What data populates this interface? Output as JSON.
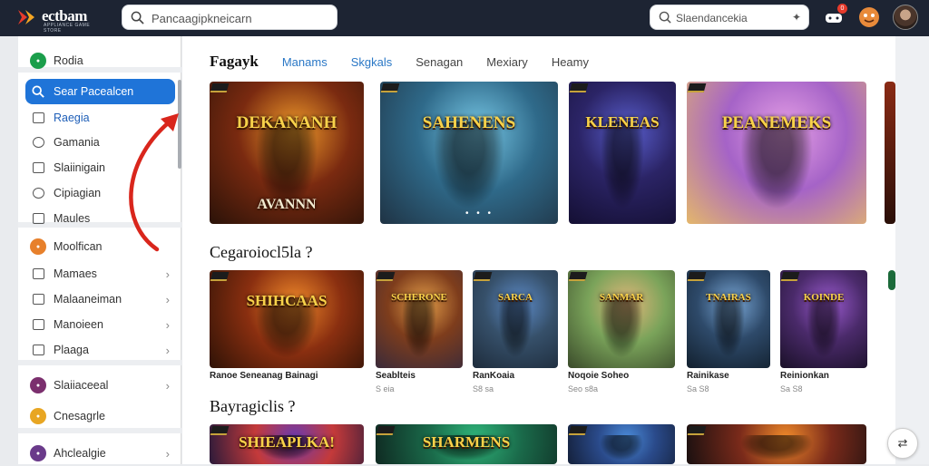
{
  "app": {
    "logo_text": "ectbam",
    "logo_tagline": "APPLIANCE GAME STORE",
    "main_search": {
      "value": "Pancaagipkneicarn",
      "placeholder": ""
    },
    "right_search": {
      "value": "Slaendancekia",
      "placeholder": ""
    },
    "notification_count": "0"
  },
  "sidebar": {
    "items": [
      {
        "label": "Rodia",
        "icon": "home-circle-icon",
        "color": "#1b9e4b"
      },
      {
        "label": "Sear Pacealcen",
        "icon": "search-icon",
        "active": true
      },
      {
        "label": "Raegia",
        "icon": "square-icon",
        "highlight": true
      },
      {
        "label": "Gamania",
        "icon": "disc-icon"
      },
      {
        "label": "Slaiinigain",
        "icon": "puzzle-icon"
      },
      {
        "label": "Cipiagian",
        "icon": "target-icon"
      },
      {
        "label": "Maules",
        "icon": "frame-icon"
      },
      {
        "label": "Moolfican",
        "icon": "orange-circle-icon",
        "color": "#e7802b"
      },
      {
        "label": "Mamaes",
        "icon": "list-icon",
        "chevron": "›"
      },
      {
        "label": "Malaaneiman",
        "icon": "lock-icon",
        "chevron": "›"
      },
      {
        "label": "Manoieen",
        "icon": "search-small-icon",
        "chevron": "›"
      },
      {
        "label": "Plaaga",
        "icon": "image-icon",
        "chevron": "›"
      },
      {
        "label": "Slaiiaceeal",
        "icon": "purple-circle-icon",
        "color": "#7b2f6e",
        "chevron": "›"
      },
      {
        "label": "Cnesagrle",
        "icon": "gold-circle-icon",
        "color": "#e8a623"
      },
      {
        "label": "Ahclealgie",
        "icon": "violet-circle-icon",
        "color": "#6a3a8a",
        "chevron": "›"
      }
    ]
  },
  "main": {
    "tabs": [
      {
        "label": "Fagayk",
        "current": true
      },
      {
        "label": "Manams",
        "blue": true
      },
      {
        "label": "Skgkals",
        "blue": true
      },
      {
        "label": "Senagan"
      },
      {
        "label": "Mexiary"
      },
      {
        "label": "Heamy"
      }
    ],
    "featured": [
      {
        "title": "DEKANANH",
        "subtitle": "AVANNN",
        "colors": [
          "#f29c2b",
          "#7a2a10",
          "#2a1208"
        ]
      },
      {
        "title": "SAHENENS",
        "subtitle": "",
        "colors": [
          "#77c7e5",
          "#2f6a8a",
          "#1f3344"
        ]
      },
      {
        "title": "KLENEAS",
        "subtitle": "",
        "colors": [
          "#5a5fcf",
          "#2b2466",
          "#140f33"
        ]
      },
      {
        "title": "PEANEMEKS",
        "subtitle": "",
        "colors": [
          "#e6a0e6",
          "#a563c7",
          "#e4b76b"
        ]
      }
    ],
    "section2_title": "Cegaroiocl5la ?",
    "section2_cards": [
      {
        "title": "SHIHCAAS",
        "caption": "Ranoe Seneanag Bainagi",
        "meta": "",
        "colors": [
          "#f0892a",
          "#8a2f10",
          "#2e1206"
        ]
      },
      {
        "title": "SCHERONE",
        "caption": "Seablteis",
        "meta": "S eia",
        "colors": [
          "#e6a04a",
          "#7e3d1c",
          "#3a2a3a"
        ]
      },
      {
        "title": "SARCA",
        "caption": "RanKoaia",
        "meta": "S8 sa",
        "colors": [
          "#5c8ac7",
          "#36506a",
          "#1e2c3c"
        ]
      },
      {
        "title": "SANMAR",
        "caption": "Noqoie Soheo",
        "meta": "Seo s8a",
        "colors": [
          "#e3b77a",
          "#7aa35a",
          "#3a4a2a"
        ]
      },
      {
        "title": "TNAIRAS",
        "caption": "Rainikase",
        "meta": "Sa S8",
        "colors": [
          "#7aa8d8",
          "#2e4a6a",
          "#12202e"
        ]
      },
      {
        "title": "KOINDE",
        "caption": "Reinionkan",
        "meta": "Sa S8",
        "colors": [
          "#9a5acf",
          "#4a2a6a",
          "#1a1028"
        ]
      }
    ],
    "section3_title": "Bayragiclis ?",
    "section3_cards": [
      {
        "title": "SHIEAPLKA!",
        "colors": [
          "#6a3ab0",
          "#c43a3a",
          "#2a1a3a"
        ]
      },
      {
        "title": "SHARMENS",
        "colors": [
          "#2fb57a",
          "#1a6a4a",
          "#0f2a22"
        ]
      },
      {
        "title": "",
        "colors": [
          "#4a8ad8",
          "#2a4a8a",
          "#14203a"
        ]
      },
      {
        "title": "",
        "colors": [
          "#f08a2a",
          "#7a2a1a",
          "#1a1010"
        ]
      },
      {
        "title": "",
        "colors": [
          "#d8742a",
          "#5a2a1a",
          "#1a1010"
        ]
      }
    ]
  }
}
